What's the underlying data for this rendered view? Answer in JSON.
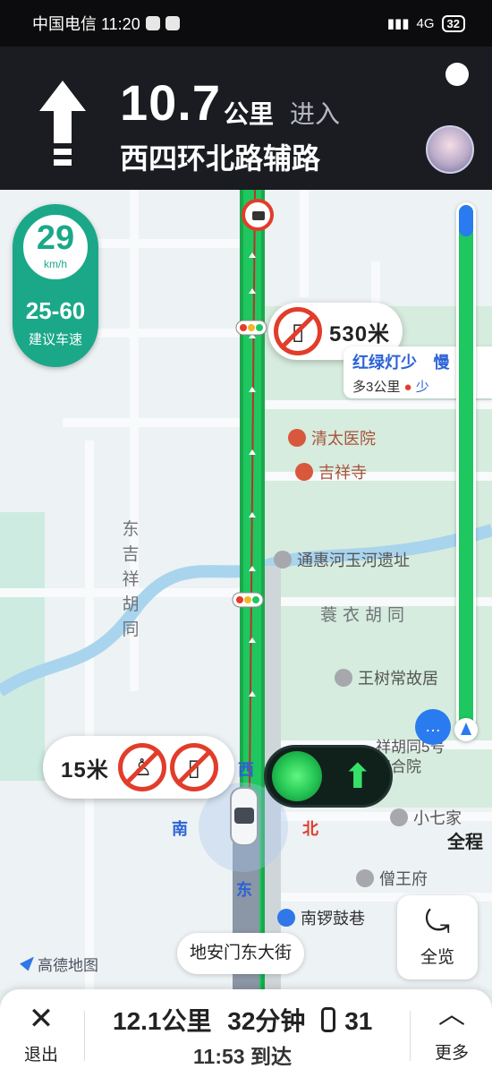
{
  "status_bar": {
    "carrier_time": "中国电信 11:20",
    "network": "4G",
    "battery": "32"
  },
  "nav": {
    "distance": "10.7",
    "distance_unit": "公里",
    "action": "进入",
    "next_road": "西四环北路辅路"
  },
  "speed": {
    "current": "29",
    "unit": "km/h",
    "range": "25-60",
    "label": "建议车速"
  },
  "callouts": {
    "no_phone_distance": "530米",
    "bottom_distance": "15米"
  },
  "traffic_card": {
    "title": "红绿灯少",
    "sub": "多3公里",
    "slow": "慢",
    "extra": "少"
  },
  "pois": [
    {
      "name": "清太医院"
    },
    {
      "name": "吉祥寺"
    },
    {
      "name": "通惠河玉河遗址"
    },
    {
      "name": "王树常故居"
    },
    {
      "name": "祥胡同5号四合院"
    },
    {
      "name": "小七家"
    },
    {
      "name": "僧王府"
    },
    {
      "name": "南锣鼓巷"
    }
  ],
  "streets": {
    "dongjixiang": "东吉祥胡同",
    "suoyi": "蓑衣胡同"
  },
  "directions": {
    "west": "西",
    "south": "南",
    "north": "北",
    "east": "东"
  },
  "right_panel": {
    "full_route": "全程",
    "progress": 0.06
  },
  "overview": {
    "label": "全览"
  },
  "current_road": "地安门东大街",
  "map_brand": "高德地图",
  "bottom": {
    "exit": "退出",
    "distance": "12.1公里",
    "duration": "32分钟",
    "lights": "31",
    "arrival": "11:53 到达",
    "more": "更多"
  },
  "colors": {
    "route_green": "#1ec75f",
    "accent_blue": "#2a7bf0",
    "speed_teal": "#1ba889",
    "ban_red": "#e23c2a"
  }
}
